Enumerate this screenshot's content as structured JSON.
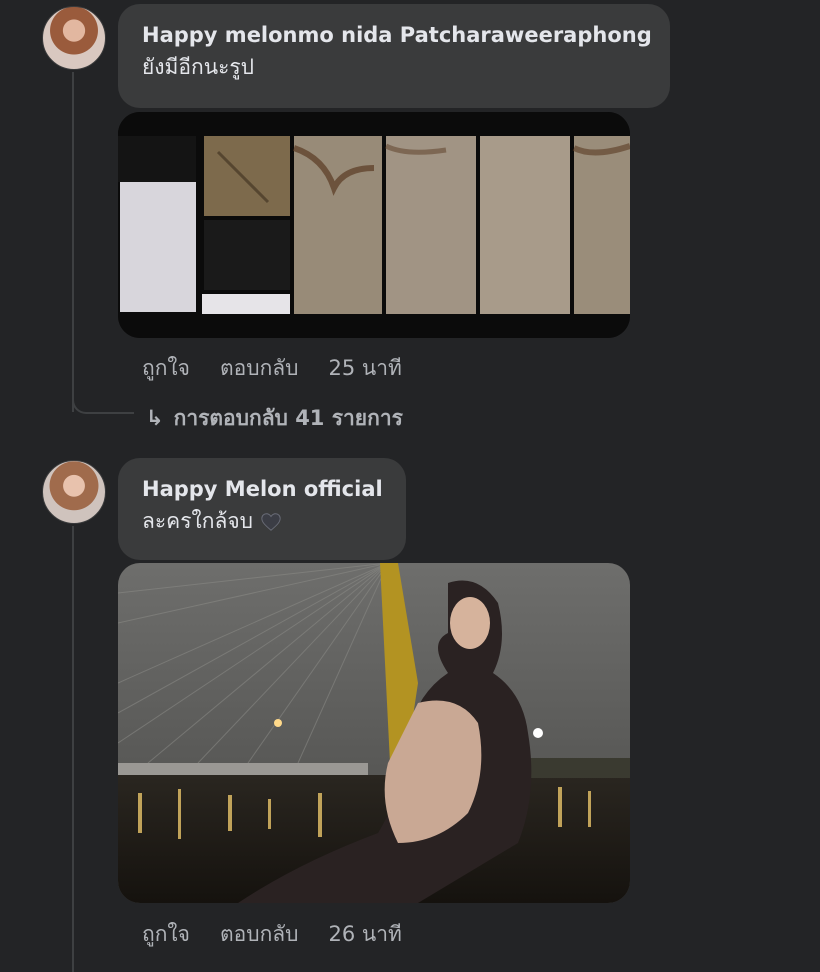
{
  "comments": [
    {
      "author": "Happy melonmo nida Patcharaweeraphong",
      "text": "ยังมีอีกนะรูป",
      "like_label": "ถูกใจ",
      "reply_label": "ตอบกลับ",
      "time": "25 นาที",
      "replies_label": "การตอบกลับ 41 รายการ"
    },
    {
      "author": "Happy Melon official",
      "text": "ละครใกล้จบ",
      "emoji": "black-heart-icon",
      "like_label": "ถูกใจ",
      "reply_label": "ตอบกลับ",
      "time": "26 นาที"
    }
  ],
  "colors": {
    "background": "#232426",
    "bubble": "#3a3b3c",
    "primary_text": "#e4e6eb",
    "secondary_text": "#b0b3b8"
  }
}
